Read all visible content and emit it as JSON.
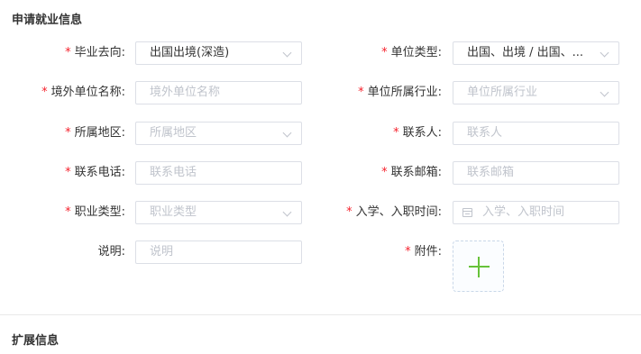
{
  "sections": {
    "apply_title": "申请就业信息",
    "extend_title": "扩展信息"
  },
  "required_mark": "*",
  "fields": {
    "destination": {
      "label": "毕业去向:",
      "value": "出国出境(深造)"
    },
    "unit_type": {
      "label": "单位类型:",
      "value": "出国、出境 / 出国、..."
    },
    "overseas_unit_name": {
      "label": "境外单位名称:",
      "placeholder": "境外单位名称"
    },
    "unit_industry": {
      "label": "单位所属行业:",
      "placeholder": "单位所属行业"
    },
    "region": {
      "label": "所属地区:",
      "placeholder": "所属地区"
    },
    "contact_person": {
      "label": "联系人:",
      "placeholder": "联系人"
    },
    "contact_phone": {
      "label": "联系电话:",
      "placeholder": "联系电话"
    },
    "contact_email": {
      "label": "联系邮箱:",
      "placeholder": "联系邮箱"
    },
    "job_type": {
      "label": "职业类型:",
      "placeholder": "职业类型"
    },
    "entry_time": {
      "label": "入学、入职时间:",
      "placeholder": "入学、入职时间"
    },
    "note": {
      "label": "说明:",
      "placeholder": "说明"
    },
    "attachment": {
      "label": "附件:"
    }
  },
  "colors": {
    "required": "#f5222d",
    "accent": "#67c23a",
    "placeholder": "#c0c4cc"
  },
  "icons": {
    "dropdown": "chevron-down-icon",
    "date": "calendar-icon",
    "upload": "plus-icon"
  }
}
